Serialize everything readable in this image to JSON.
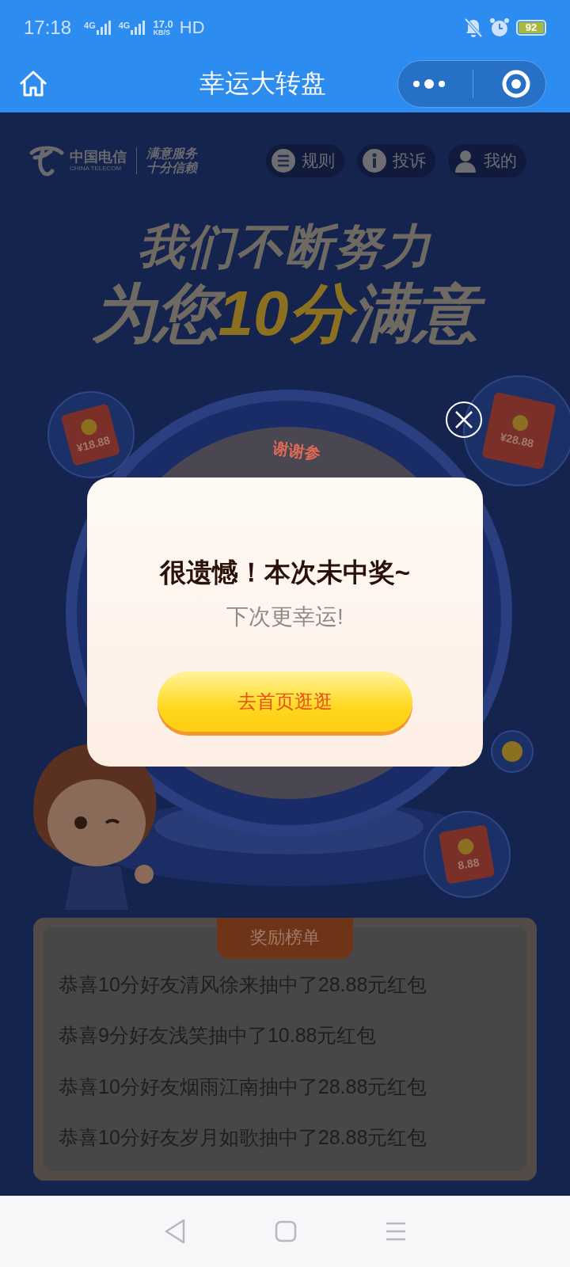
{
  "status_bar": {
    "time": "17:18",
    "network_labels": [
      "4G",
      "4G"
    ],
    "speed_value": "17.0",
    "speed_unit": "KB/S",
    "hd": "HD",
    "battery": "92"
  },
  "nav": {
    "title": "幸运大转盘"
  },
  "brand": {
    "name": "中国电信",
    "name_en": "CHINA TELECOM",
    "slogan": [
      "满意服务",
      "十分信赖"
    ]
  },
  "header_buttons": [
    {
      "kind": "rules",
      "label": "规则"
    },
    {
      "kind": "complaint",
      "label": "投诉"
    },
    {
      "kind": "mine",
      "label": "我的"
    }
  ],
  "headline": {
    "line1": "我们不断努力",
    "line2": {
      "before": "为您",
      "highlight": "10分",
      "after": "满意"
    }
  },
  "wheel": {
    "label": "谢谢参"
  },
  "red_packets": [
    {
      "amount": "¥18.88"
    },
    {
      "amount": "¥28.88"
    },
    {
      "amount": "8.88"
    }
  ],
  "leaderboard": {
    "title": "奖励榜单",
    "entries": [
      "恭喜10分好友清风徐来抽中了28.88元红包",
      "恭喜9分好友浅笑抽中了10.88元红包",
      "恭喜10分好友烟雨江南抽中了28.88元红包",
      "恭喜10分好友岁月如歌抽中了28.88元红包"
    ]
  },
  "dialog": {
    "title": "很遗憾！本次未中奖~",
    "subtitle": "下次更幸运!",
    "button": "去首页逛逛"
  }
}
